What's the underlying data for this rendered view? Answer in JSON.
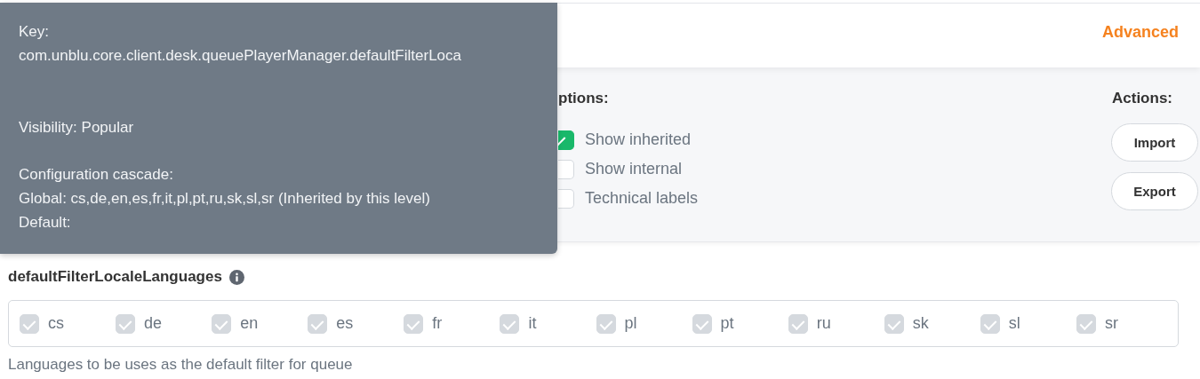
{
  "header": {
    "advanced_link": "Advanced"
  },
  "options": {
    "title": "ptions:",
    "items": [
      {
        "label": "Show inherited",
        "checked": true
      },
      {
        "label": "Show internal",
        "checked": false
      },
      {
        "label": "Technical labels",
        "checked": false
      }
    ]
  },
  "actions": {
    "title": "Actions:",
    "buttons": [
      "Import",
      "Export"
    ]
  },
  "setting": {
    "name": "defaultFilterLocaleLanguages",
    "description": "Languages to be uses as the default filter for queue",
    "languages": [
      {
        "label": "cs",
        "checked": true,
        "disabled": true
      },
      {
        "label": "de",
        "checked": true,
        "disabled": true
      },
      {
        "label": "en",
        "checked": true,
        "disabled": true
      },
      {
        "label": "es",
        "checked": true,
        "disabled": true
      },
      {
        "label": "fr",
        "checked": true,
        "disabled": true
      },
      {
        "label": "it",
        "checked": true,
        "disabled": true
      },
      {
        "label": "pl",
        "checked": true,
        "disabled": true
      },
      {
        "label": "pt",
        "checked": true,
        "disabled": true
      },
      {
        "label": "ru",
        "checked": true,
        "disabled": true
      },
      {
        "label": "sk",
        "checked": true,
        "disabled": true
      },
      {
        "label": "sl",
        "checked": true,
        "disabled": true
      },
      {
        "label": "sr",
        "checked": true,
        "disabled": true
      }
    ]
  },
  "tooltip": {
    "lines": [
      "Key:",
      "com.unblu.core.client.desk.queuePlayerManager.defaultFilterLoca",
      "Visibility: Popular",
      "Configuration cascade:",
      "Global: cs,de,en,es,fr,it,pl,pt,ru,sk,sl,sr (Inherited by this level)",
      "Default:"
    ]
  }
}
